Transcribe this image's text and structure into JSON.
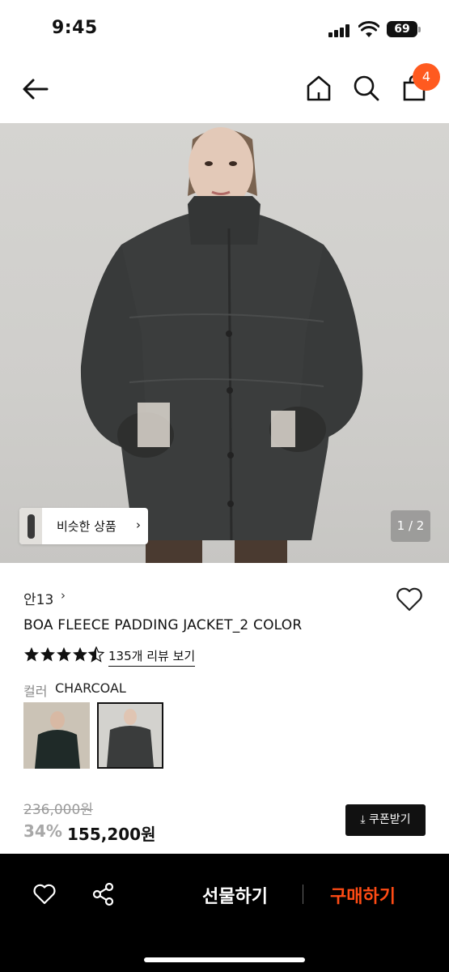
{
  "status_bar": {
    "time": "9:45",
    "battery": "69"
  },
  "nav": {
    "cart_count": "4"
  },
  "hero": {
    "similar_label": "비슷한 상품",
    "page_indicator": "1 / 2"
  },
  "product": {
    "brand": "안13",
    "title": "BOA FLEECE PADDING JACKET_2 COLOR",
    "rating": 4.5,
    "review_link": "135개 리뷰 보기",
    "color_label": "컬러",
    "color_value": "CHARCOAL",
    "original_price": "236,000원",
    "discount": "34%",
    "sale_price": "155,200원",
    "coupon_label": "쿠폰받기"
  },
  "bottom_bar": {
    "gift_label": "선물하기",
    "buy_label": "구매하기"
  },
  "colors": {
    "accent": "#ff4b14",
    "badge": "#ff5a1f",
    "jacket": "#3b3d3d"
  }
}
